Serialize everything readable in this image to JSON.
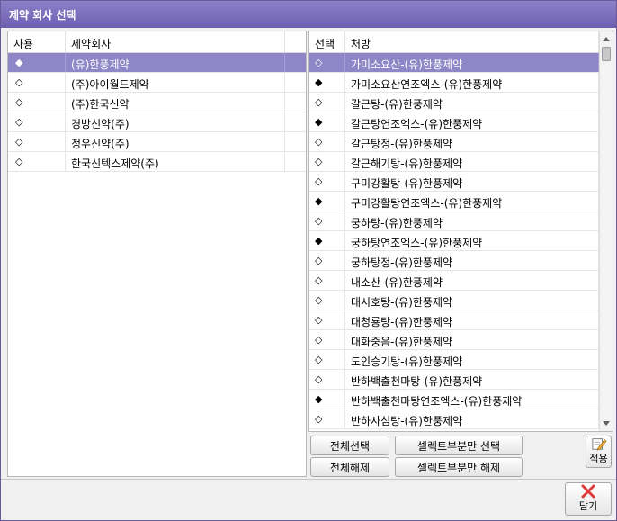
{
  "window": {
    "title": "제약 회사 선택"
  },
  "colors": {
    "titlebar": "#7466b8",
    "selected_row": "#8e86c6"
  },
  "left_grid": {
    "headers": [
      "사용",
      "제약회사"
    ],
    "rows": [
      {
        "use": "◆",
        "name": "(유)한풍제약",
        "selected": true
      },
      {
        "use": "◇",
        "name": "(주)아이월드제약",
        "selected": false
      },
      {
        "use": "◇",
        "name": "(주)한국신약",
        "selected": false
      },
      {
        "use": "◇",
        "name": "경방신약(주)",
        "selected": false
      },
      {
        "use": "◇",
        "name": "정우신약(주)",
        "selected": false
      },
      {
        "use": "◇",
        "name": "한국신텍스제약(주)",
        "selected": false
      }
    ]
  },
  "right_grid": {
    "headers": [
      "선택",
      "처방"
    ],
    "rows": [
      {
        "sel": "◇",
        "rx": "가미소요산-(유)한풍제약",
        "selected": true
      },
      {
        "sel": "◆",
        "rx": "가미소요산연조엑스-(유)한풍제약",
        "selected": false
      },
      {
        "sel": "◇",
        "rx": "갈근탕-(유)한풍제약",
        "selected": false
      },
      {
        "sel": "◆",
        "rx": "갈근탕연조엑스-(유)한풍제약",
        "selected": false
      },
      {
        "sel": "◇",
        "rx": "갈근탕정-(유)한풍제약",
        "selected": false
      },
      {
        "sel": "◇",
        "rx": "갈근해기탕-(유)한풍제약",
        "selected": false
      },
      {
        "sel": "◇",
        "rx": "구미강활탕-(유)한풍제약",
        "selected": false
      },
      {
        "sel": "◆",
        "rx": "구미강활탕연조엑스-(유)한풍제약",
        "selected": false
      },
      {
        "sel": "◇",
        "rx": "궁하탕-(유)한풍제약",
        "selected": false
      },
      {
        "sel": "◆",
        "rx": "궁하탕연조엑스-(유)한풍제약",
        "selected": false
      },
      {
        "sel": "◇",
        "rx": "궁하탕정-(유)한풍제약",
        "selected": false
      },
      {
        "sel": "◇",
        "rx": "내소산-(유)한풍제약",
        "selected": false
      },
      {
        "sel": "◇",
        "rx": "대시호탕-(유)한풍제약",
        "selected": false
      },
      {
        "sel": "◇",
        "rx": "대청룡탕-(유)한풍제약",
        "selected": false
      },
      {
        "sel": "◇",
        "rx": "대화중음-(유)한풍제약",
        "selected": false
      },
      {
        "sel": "◇",
        "rx": "도인승기탕-(유)한풍제약",
        "selected": false
      },
      {
        "sel": "◇",
        "rx": "반하백출천마탕-(유)한풍제약",
        "selected": false
      },
      {
        "sel": "◆",
        "rx": "반하백출천마탕연조엑스-(유)한풍제약",
        "selected": false
      },
      {
        "sel": "◇",
        "rx": "반하사심탕-(유)한풍제약",
        "selected": false
      }
    ]
  },
  "buttons": {
    "select_all": "전체선택",
    "deselect_all": "전체해제",
    "select_part": "셀렉트부분만 선택",
    "deselect_part": "셀렉트부분만 해제",
    "apply": "적용",
    "close": "닫기"
  }
}
